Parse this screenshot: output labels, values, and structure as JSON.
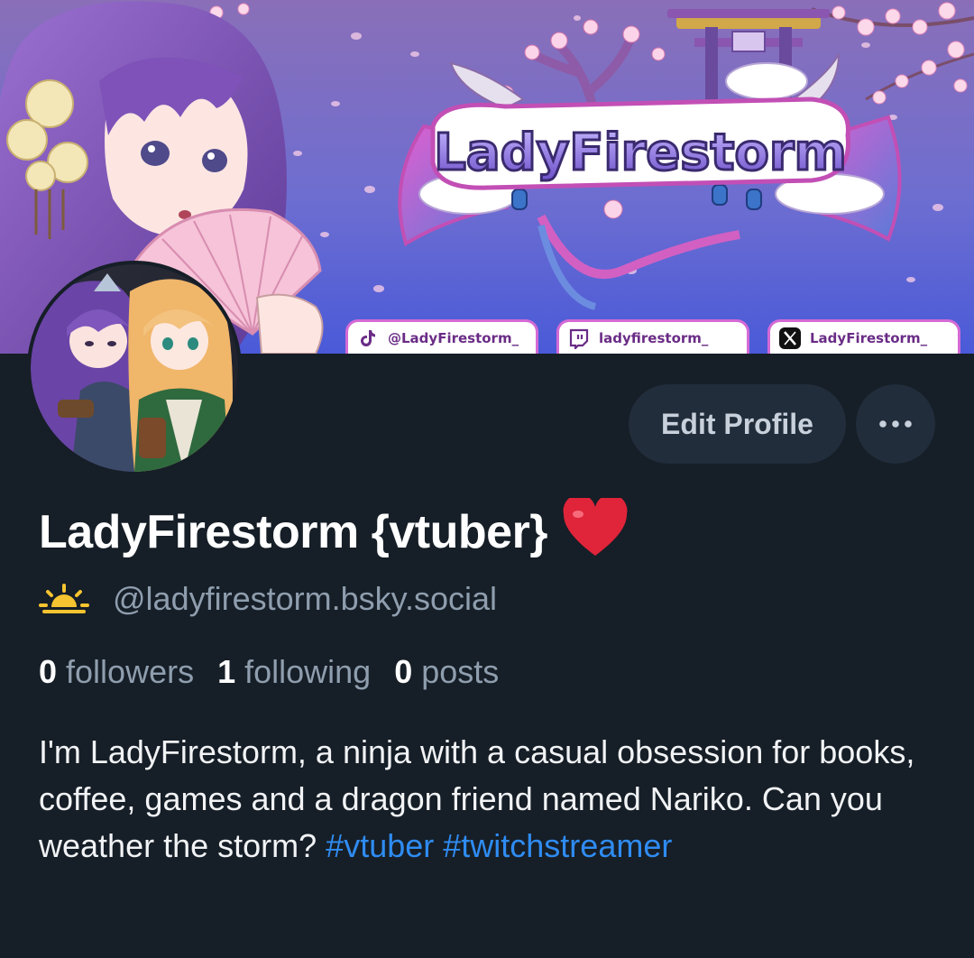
{
  "banner": {
    "logo_text": "LadyFirestorm",
    "socials": [
      {
        "platform": "tiktok",
        "icon": "tiktok-icon",
        "label": "@LadyFirestorm_"
      },
      {
        "platform": "twitch",
        "icon": "twitch-icon",
        "label": "ladyfirestorm_"
      },
      {
        "platform": "x",
        "icon": "x-icon",
        "label": "LadyFirestorm_"
      }
    ]
  },
  "profile": {
    "display_name": "LadyFirestorm {vtuber}",
    "name_emoji": "❤️",
    "handle_icon": "sunrise-icon",
    "handle": "@ladyfirestorm.bsky.social",
    "stats": {
      "followers_count": "0",
      "followers_label": "followers",
      "following_count": "1",
      "following_label": "following",
      "posts_count": "0",
      "posts_label": "posts"
    },
    "bio_text": "I'm LadyFirestorm, a ninja with a casual obsession for books, coffee, games and a dragon friend named Nariko. Can you weather the storm?",
    "bio_tags": [
      "#vtuber",
      "#twitchstreamer"
    ]
  },
  "actions": {
    "edit_label": "Edit Profile",
    "more_icon": "more-horizontal-icon"
  },
  "colors": {
    "background": "#161e27",
    "button_bg": "#212d3b",
    "muted_text": "#8f9eae",
    "link": "#2f8cf2",
    "accent_pink": "#d46ad6"
  }
}
